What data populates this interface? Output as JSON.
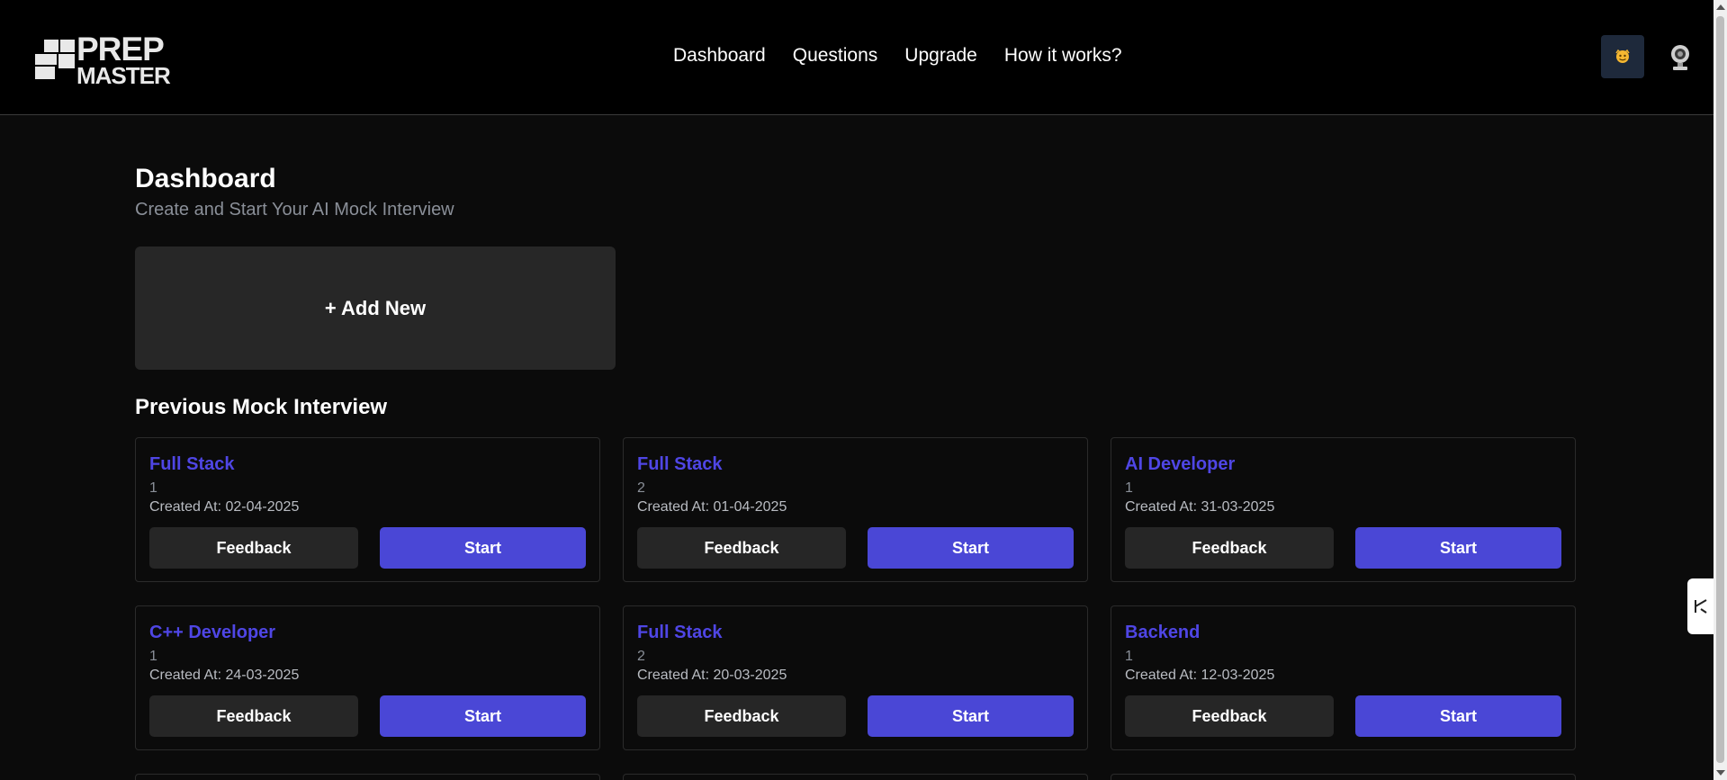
{
  "header": {
    "logo": {
      "line1": "PREP",
      "line2": "MASTER"
    },
    "nav": [
      "Dashboard",
      "Questions",
      "Upgrade",
      "How it works?"
    ]
  },
  "page": {
    "title": "Dashboard",
    "subtitle": "Create and Start Your AI Mock Interview",
    "add_new_label": "+ Add New",
    "section_title": "Previous Mock Interview"
  },
  "interviews": [
    {
      "role": "Full Stack",
      "experience": "1",
      "created": "Created At: 02-04-2025",
      "feedback_label": "Feedback",
      "start_label": "Start"
    },
    {
      "role": "Full Stack",
      "experience": "2",
      "created": "Created At: 01-04-2025",
      "feedback_label": "Feedback",
      "start_label": "Start"
    },
    {
      "role": "AI Developer",
      "experience": "1",
      "created": "Created At: 31-03-2025",
      "feedback_label": "Feedback",
      "start_label": "Start"
    },
    {
      "role": "C++ Developer",
      "experience": "1",
      "created": "Created At: 24-03-2025",
      "feedback_label": "Feedback",
      "start_label": "Start"
    },
    {
      "role": "Full Stack",
      "experience": "2",
      "created": "Created At: 20-03-2025",
      "feedback_label": "Feedback",
      "start_label": "Start"
    },
    {
      "role": "Backend",
      "experience": "1",
      "created": "Created At: 12-03-2025",
      "feedback_label": "Feedback",
      "start_label": "Start"
    }
  ],
  "colors": {
    "background": "#0b0b0b",
    "header": "#000000",
    "accent": "#4a47d6",
    "title_accent": "#4f46e5",
    "secondary_button": "#262626"
  },
  "icons": {
    "avatar": "user-avatar-icon",
    "webcam": "webcam-icon",
    "side_widget": "side-widget-icon"
  }
}
